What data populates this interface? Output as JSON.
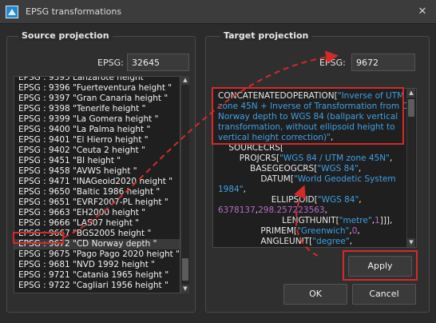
{
  "window": {
    "title": "EPSG transformations",
    "close_glyph": "✕"
  },
  "source": {
    "title": "Source projection",
    "epsg_label": "EPSG:",
    "epsg_value": "32645",
    "list_top_partial": "Lanzarote height",
    "list": [
      {
        "code": "EPSG : 9396",
        "name": "\"Fuerteventura height \""
      },
      {
        "code": "EPSG : 9397",
        "name": "\"Gran Canaria height \""
      },
      {
        "code": "EPSG : 9398",
        "name": "\"Tenerife height \""
      },
      {
        "code": "EPSG : 9399",
        "name": "\"La Gomera height \""
      },
      {
        "code": "EPSG : 9400",
        "name": "\"La Palma height \""
      },
      {
        "code": "EPSG : 9401",
        "name": "\"El Hierro height \""
      },
      {
        "code": "EPSG : 9402",
        "name": "\"Ceuta 2 height \""
      },
      {
        "code": "EPSG : 9451",
        "name": "\"BI height \""
      },
      {
        "code": "EPSG : 9458",
        "name": "\"AVWS height \""
      },
      {
        "code": "EPSG : 9471",
        "name": "\"INAGeoid2020 height \""
      },
      {
        "code": "EPSG : 9650",
        "name": "\"Baltic 1986 height \""
      },
      {
        "code": "EPSG : 9651",
        "name": "\"EVRF2007-PL height \""
      },
      {
        "code": "EPSG : 9663",
        "name": "\"EH2000 height \""
      },
      {
        "code": "EPSG : 9666",
        "name": "\"LAS07 height \""
      },
      {
        "code": "EPSG : 9667",
        "name": "\"BGS2005 height \""
      },
      {
        "code": "EPSG : 9672",
        "name": "\"CD Norway depth \""
      },
      {
        "code": "EPSG : 9675",
        "name": "\"Pago Pago 2020 height \""
      },
      {
        "code": "EPSG : 9681",
        "name": "\"NVD 1992 height \""
      },
      {
        "code": "EPSG : 9721",
        "name": "\"Catania 1965 height \""
      },
      {
        "code": "EPSG : 9722",
        "name": "\"Cagliari 1956 height \""
      }
    ],
    "selected_index": 15
  },
  "target": {
    "title": "Target projection",
    "epsg_label": "EPSG:",
    "epsg_value": "9672",
    "wkt_lines": [
      [
        {
          "t": "kw",
          "v": "CONCATENATEDOPERATION["
        },
        {
          "t": "str",
          "v": "\"Inverse of UTM"
        }
      ],
      [
        {
          "t": "str",
          "v": "zone 45N + Inverse of Transformation from CD"
        }
      ],
      [
        {
          "t": "str",
          "v": "Norway depth to WGS 84 (ballpark vertical"
        }
      ],
      [
        {
          "t": "str",
          "v": "transformation, without ellipsoid height to"
        }
      ],
      [
        {
          "t": "str",
          "v": "vertical height correction)\""
        },
        {
          "t": "kw",
          "v": ","
        }
      ],
      [
        {
          "t": "kw",
          "v": "    SOURCECRS["
        }
      ],
      [
        {
          "t": "kw",
          "v": "        PROJCRS["
        },
        {
          "t": "str",
          "v": "\"WGS 84 / UTM zone 45N\""
        },
        {
          "t": "kw",
          "v": ","
        }
      ],
      [
        {
          "t": "kw",
          "v": "            BASEGEOGCRS["
        },
        {
          "t": "str",
          "v": "\"WGS 84\""
        },
        {
          "t": "kw",
          "v": ","
        }
      ],
      [
        {
          "t": "kw",
          "v": "                DATUM["
        },
        {
          "t": "str",
          "v": "\"World Geodetic System"
        }
      ],
      [
        {
          "t": "str",
          "v": "1984\""
        },
        {
          "t": "kw",
          "v": ","
        }
      ],
      [
        {
          "t": "kw",
          "v": "                    ELLIPSOID["
        },
        {
          "t": "str",
          "v": "\"WGS 84\""
        },
        {
          "t": "kw",
          "v": ","
        }
      ],
      [
        {
          "t": "num",
          "v": "6378137"
        },
        {
          "t": "kw",
          "v": ","
        },
        {
          "t": "num",
          "v": "298.257223563"
        },
        {
          "t": "kw",
          "v": ","
        }
      ],
      [
        {
          "t": "kw",
          "v": "                        LENGTHUNIT["
        },
        {
          "t": "str",
          "v": "\"metre\""
        },
        {
          "t": "kw",
          "v": ","
        },
        {
          "t": "num",
          "v": "1"
        },
        {
          "t": "kw",
          "v": "]]],"
        }
      ],
      [
        {
          "t": "kw",
          "v": "                PRIMEM["
        },
        {
          "t": "str",
          "v": "\"Greenwich\""
        },
        {
          "t": "kw",
          "v": ","
        },
        {
          "t": "num",
          "v": "0"
        },
        {
          "t": "kw",
          "v": ","
        }
      ],
      [
        {
          "t": "kw",
          "v": "                ANGLEUNIT["
        },
        {
          "t": "str",
          "v": "\"degree\""
        },
        {
          "t": "kw",
          "v": ","
        }
      ]
    ]
  },
  "buttons": {
    "apply": "Apply",
    "ok": "OK",
    "cancel": "Cancel"
  },
  "colors": {
    "annotation": "#d42a2a",
    "accent_blue": "#3fa0e6",
    "number": "#b86ac8"
  }
}
